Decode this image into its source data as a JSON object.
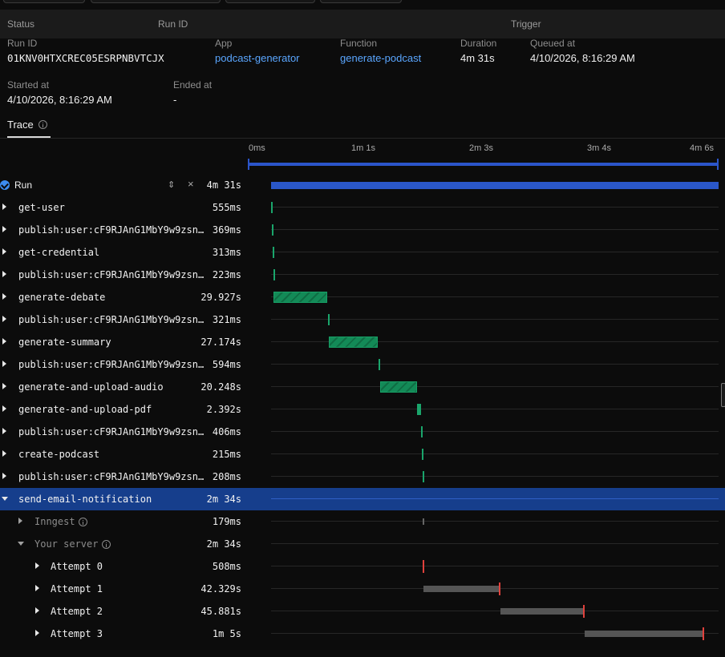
{
  "header": {
    "columns": {
      "status": "Status",
      "run_id": "Run ID",
      "trigger": "Trigger"
    }
  },
  "run": {
    "run_id_label": "Run ID",
    "run_id": "01KNV0HTXCREC05ESRPNBVTCJX",
    "app_label": "App",
    "app": "podcast-generator",
    "function_label": "Function",
    "function": "generate-podcast",
    "duration_label": "Duration",
    "duration": "4m 31s",
    "queued_label": "Queued at",
    "queued_at": "4/10/2026, 8:16:29 AM",
    "started_label": "Started at",
    "started_at": "4/10/2026, 8:16:29 AM",
    "ended_label": "Ended at",
    "ended_at": "-"
  },
  "trace": {
    "tab_label": "Trace",
    "timeline_labels": [
      "0ms",
      "1m 1s",
      "2m 3s",
      "3m 4s",
      "4m 6s"
    ],
    "root": {
      "name": "Run",
      "duration": "4m 31s",
      "status": "completed"
    },
    "rows": [
      {
        "name": "get-user",
        "duration": "555ms",
        "expanded": false
      },
      {
        "name": "publish:user:cF9RJAnG1MbY9w9zsn…",
        "duration": "369ms",
        "expanded": false
      },
      {
        "name": "get-credential",
        "duration": "313ms",
        "expanded": false
      },
      {
        "name": "publish:user:cF9RJAnG1MbY9w9zsn…",
        "duration": "223ms",
        "expanded": false
      },
      {
        "name": "generate-debate",
        "duration": "29.927s",
        "expanded": false
      },
      {
        "name": "publish:user:cF9RJAnG1MbY9w9zsn…",
        "duration": "321ms",
        "expanded": false
      },
      {
        "name": "generate-summary",
        "duration": "27.174s",
        "expanded": false
      },
      {
        "name": "publish:user:cF9RJAnG1MbY9w9zsn…",
        "duration": "594ms",
        "expanded": false
      },
      {
        "name": "generate-and-upload-audio",
        "duration": "20.248s",
        "expanded": false
      },
      {
        "name": "generate-and-upload-pdf",
        "duration": "2.392s",
        "expanded": false
      },
      {
        "name": "publish:user:cF9RJAnG1MbY9w9zsn…",
        "duration": "406ms",
        "expanded": false
      },
      {
        "name": "create-podcast",
        "duration": "215ms",
        "expanded": false
      },
      {
        "name": "publish:user:cF9RJAnG1MbY9w9zsn…",
        "duration": "208ms",
        "expanded": false
      },
      {
        "name": "send-email-notification",
        "duration": "2m 34s",
        "expanded": true,
        "selected": true
      }
    ],
    "sub_rows": [
      {
        "name": "Inngest",
        "duration": "179ms",
        "expanded": false
      },
      {
        "name": "Your server",
        "duration": "2m 34s",
        "expanded": true
      }
    ],
    "attempts": [
      {
        "name": "Attempt 0",
        "duration": "508ms"
      },
      {
        "name": "Attempt 1",
        "duration": "42.329s"
      },
      {
        "name": "Attempt 2",
        "duration": "45.881s"
      },
      {
        "name": "Attempt 3",
        "duration": "1m 5s"
      }
    ]
  },
  "colors": {
    "accent_blue": "#2a57c8",
    "link": "#5aa6ff",
    "step_green": "#138a57",
    "failure_red": "#e0413c"
  }
}
